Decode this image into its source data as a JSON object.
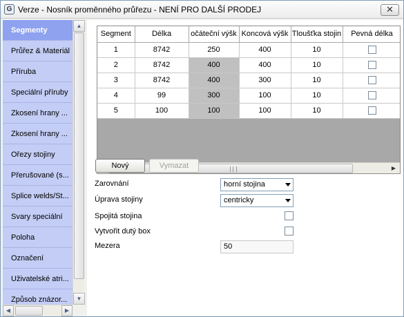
{
  "window": {
    "title": "Verze - Nosník proměnného průřezu - NENÍ PRO DALŠÍ PRODEJ",
    "app_icon": "app-logo-icon",
    "close_label": "✕"
  },
  "sidebar": {
    "items": [
      {
        "label": "Segmenty"
      },
      {
        "label": "Průřez & Materiál"
      },
      {
        "label": "Příruba"
      },
      {
        "label": "Speciální příruby"
      },
      {
        "label": "Zkosení hrany ..."
      },
      {
        "label": "Zkosení hrany ..."
      },
      {
        "label": "Ořezy stojiny"
      },
      {
        "label": "Přerušované (s..."
      },
      {
        "label": "Splice welds/St..."
      },
      {
        "label": "Svary speciální"
      },
      {
        "label": "Poloha"
      },
      {
        "label": "Označení"
      },
      {
        "label": "Uživatelské atri..."
      },
      {
        "label": "Způsob znázor..."
      }
    ],
    "active_index": 0
  },
  "grid": {
    "columns": [
      "Segment",
      "Délka",
      "očáteční výšk",
      "Koncová výšk",
      "Tloušťka stojin",
      "Pevná délka"
    ],
    "rows": [
      {
        "segment": "1",
        "delka": "8742",
        "pocatecni": "250",
        "koncova": "400",
        "tloustka": "10",
        "pevna": false
      },
      {
        "segment": "2",
        "delka": "8742",
        "pocatecni": "400",
        "koncova": "400",
        "tloustka": "10",
        "pevna": false
      },
      {
        "segment": "3",
        "delka": "8742",
        "pocatecni": "400",
        "koncova": "300",
        "tloustka": "10",
        "pevna": false
      },
      {
        "segment": "4",
        "delka": "99",
        "pocatecni": "300",
        "koncova": "100",
        "tloustka": "10",
        "pevna": false
      },
      {
        "segment": "5",
        "delka": "100",
        "pocatecni": "100",
        "koncova": "100",
        "tloustka": "10",
        "pevna": false
      }
    ]
  },
  "buttons": {
    "new": "Nový",
    "delete": "Vymazat"
  },
  "form": {
    "zarovnani_label": "Zarovnání",
    "zarovnani_value": "horní stojina",
    "uprava_label": "Úprava stojiny",
    "uprava_value": "centricky",
    "spojita_label": "Spojitá stojina",
    "duty_label": "Vytvořit dutý box",
    "mezera_label": "Mezera",
    "mezera_value": "50"
  },
  "colors": {
    "sidebar_bg": "#c3cdf5",
    "sidebar_active": "#8ea2f0",
    "shaded_cell": "#c0c0c0"
  }
}
